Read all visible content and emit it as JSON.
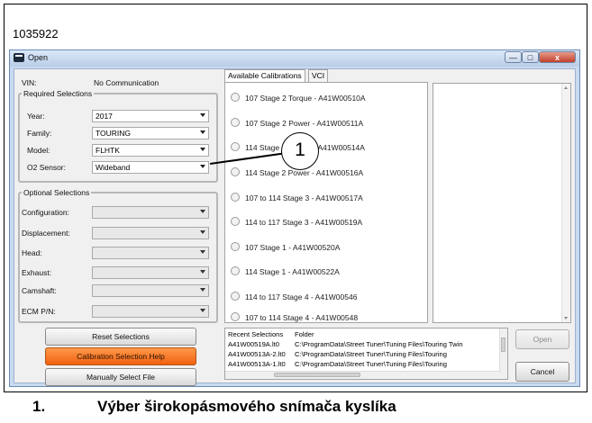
{
  "figure_id": "1035922",
  "window": {
    "title": "Open",
    "min": "—",
    "max": "□",
    "close": "x"
  },
  "vin": {
    "label": "VIN:",
    "status": "No Communication"
  },
  "required": {
    "legend": "Required Selections",
    "fields": [
      {
        "label": "Year:",
        "value": "2017"
      },
      {
        "label": "Family:",
        "value": "TOURING"
      },
      {
        "label": "Model:",
        "value": "FLHTK"
      },
      {
        "label": "O2 Sensor:",
        "value": "Wideband"
      }
    ]
  },
  "optional": {
    "legend": "Optional Selections",
    "fields": [
      {
        "label": "Configuration:",
        "value": ""
      },
      {
        "label": "Displacement:",
        "value": ""
      },
      {
        "label": "Head:",
        "value": ""
      },
      {
        "label": "Exhaust:",
        "value": ""
      },
      {
        "label": "Camshaft:",
        "value": ""
      },
      {
        "label": "ECM P/N:",
        "value": ""
      }
    ]
  },
  "buttons": {
    "reset": "Reset Selections",
    "help": "Calibration Selection Help",
    "manual": "Manually Select File",
    "open": "Open",
    "cancel": "Cancel"
  },
  "tabs": [
    {
      "label": "Available Calibrations"
    },
    {
      "label": "VCI"
    }
  ],
  "calibrations": [
    "107 Stage 2 Torque - A41W00510A",
    "107 Stage 2 Power - A41W00511A",
    "114 Stage 2 Torque - A41W00514A",
    "114 Stage 2 Power - A41W00516A",
    "107 to 114 Stage 3 - A41W00517A",
    "114 to 117 Stage 3 - A41W00519A",
    "107 Stage 1 - A41W00520A",
    "114 Stage 1 - A41W00522A",
    "114 to 117 Stage 4 - A41W00546",
    "107 to 114 Stage 4 - A41W00548"
  ],
  "recent": {
    "headers": [
      "Recent Selections",
      "Folder"
    ],
    "rows": [
      {
        "file": "A41W00519A.lt0",
        "folder": "C:\\ProgramData\\Street Tuner\\Tuning Files\\Touring Twin"
      },
      {
        "file": "A41W00513A-2.lt0",
        "folder": "C:\\ProgramData\\Street Tuner\\Tuning Files\\Touring"
      },
      {
        "file": "A41W00513A-1.lt0",
        "folder": "C:\\ProgramData\\Street Tuner\\Tuning Files\\Touring"
      }
    ]
  },
  "callout": {
    "number": "1"
  },
  "caption": {
    "number": "1.",
    "text": "Výber širokopásmového snímača kyslíka"
  }
}
